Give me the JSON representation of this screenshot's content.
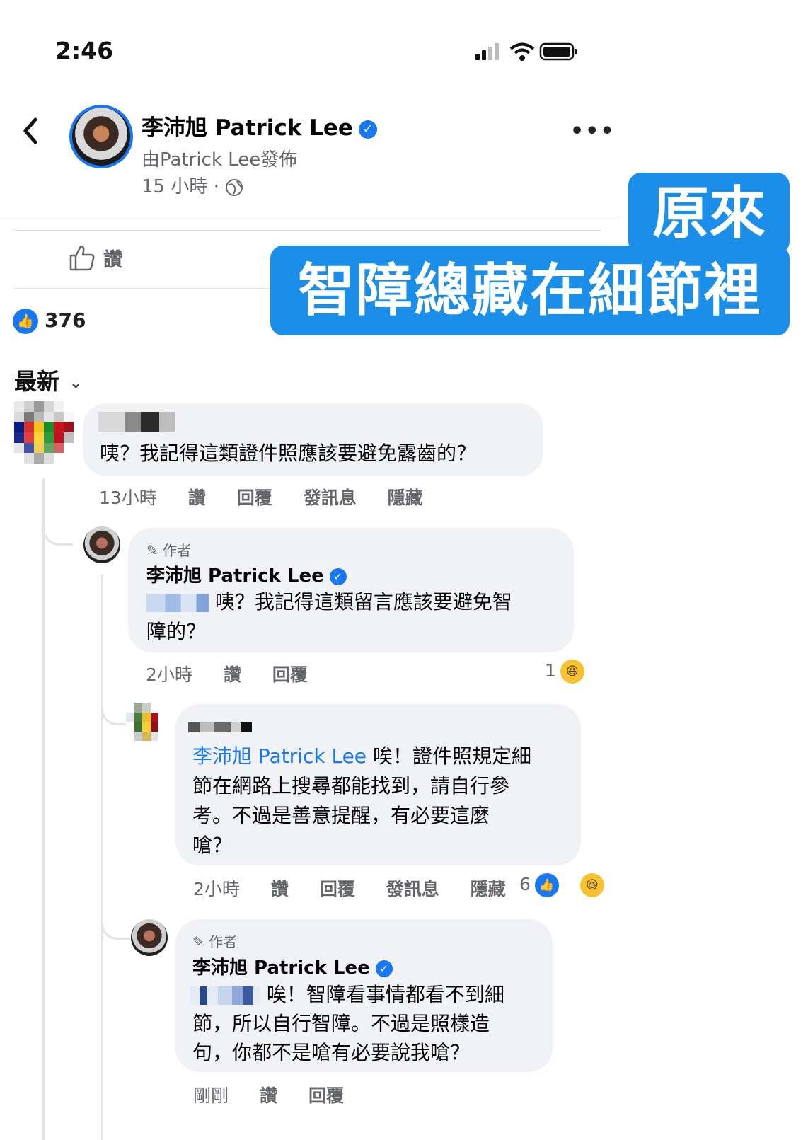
{
  "status_bar": {
    "time": "2:46"
  },
  "header": {
    "page_name": "李沛旭 Patrick Lee",
    "posted_by": "由Patrick Lee發佈",
    "post_time": "15 小時 ·"
  },
  "actions": {
    "like": "讚"
  },
  "reactions": {
    "count": "376"
  },
  "sort": {
    "label": "最新"
  },
  "banner": {
    "line1": "原來",
    "line2": "智障總藏在細節裡"
  },
  "comments": [
    {
      "text": "咦？我記得這類證件照應該要避免露齒的？",
      "time": "13小時",
      "like": "讚",
      "reply": "回覆",
      "message": "發訊息",
      "hide": "隱藏"
    },
    {
      "author_tag": "作者",
      "name": "李沛旭 Patrick Lee",
      "text_line1": "咦？我記得這類留言應該要避免智",
      "text_line2": "障的？",
      "time": "2小時",
      "like": "讚",
      "reply": "回覆",
      "reaction_count": "1"
    },
    {
      "mention": "李沛旭 Patrick Lee",
      "text_line1": "唉！證件照規定細",
      "text_line2": "節在網路上搜尋都能找到，請自行參",
      "text_line3": "考。不過是善意提醒，有必要這麼",
      "text_line4": "嗆？",
      "time": "2小時",
      "like": "讚",
      "reply": "回覆",
      "message": "發訊息",
      "hide": "隱藏",
      "reaction_count": "6"
    },
    {
      "author_tag": "作者",
      "name": "李沛旭 Patrick Lee",
      "text_line1": "唉！智障看事情都看不到細",
      "text_line2": "節，所以自行智障。不過是照樣造",
      "text_line3": "句，你都不是嗆有必要說我嗆？",
      "time": "剛剛",
      "like": "讚",
      "reply": "回覆"
    }
  ]
}
